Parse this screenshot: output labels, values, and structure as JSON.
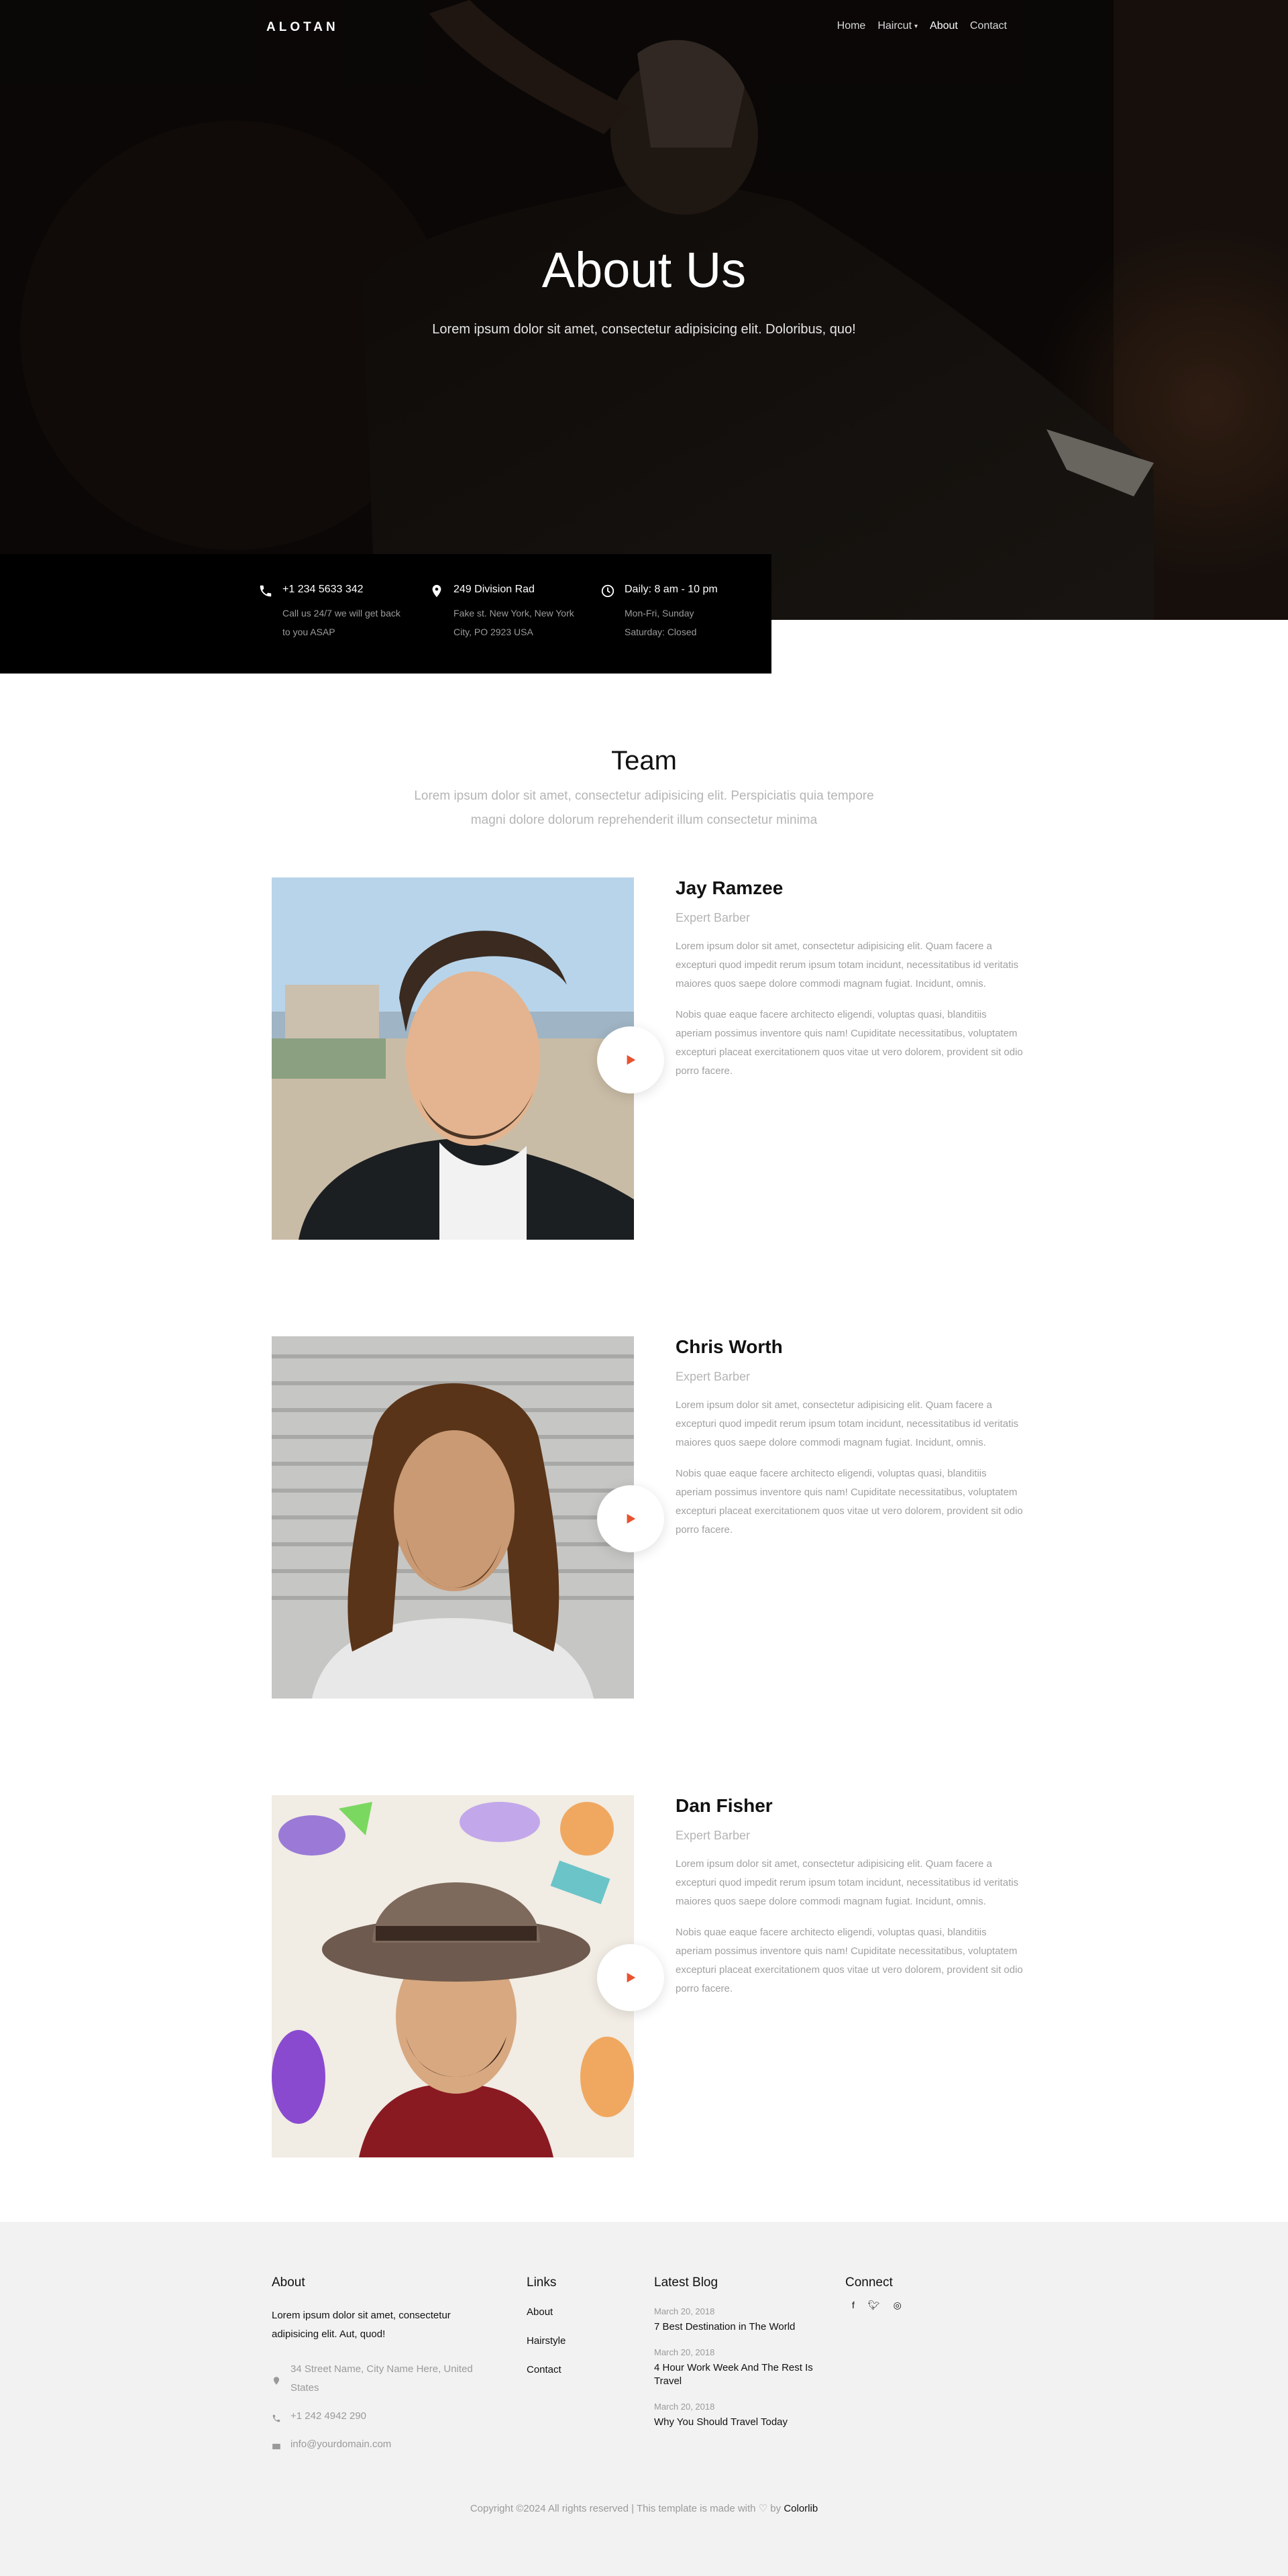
{
  "colors": {
    "accent": "#e8522e",
    "hero_bg": "#17100e",
    "footer_bg": "#f2f2f2"
  },
  "nav": {
    "logo": "ALOTAN",
    "items": [
      {
        "label": "Home"
      },
      {
        "label": "Haircut"
      },
      {
        "label": "About"
      },
      {
        "label": "Contact"
      }
    ]
  },
  "hero": {
    "title": "About Us",
    "subtitle": "Lorem ipsum dolor sit amet, consectetur adipisicing elit. Doloribus, quo!"
  },
  "info": [
    {
      "icon": "phone-icon",
      "title": "+1 234 5633 342",
      "lines": [
        "Call us 24/7 we will get back",
        "to you ASAP"
      ]
    },
    {
      "icon": "map-pin-icon",
      "title": "249 Division Rad",
      "lines": [
        "Fake st. New York, New York",
        "City, PO 2923 USA"
      ]
    },
    {
      "icon": "clock-icon",
      "title": "Daily: 8 am - 10 pm",
      "lines": [
        "Mon-Fri, Sunday",
        "Saturday: Closed"
      ]
    }
  ],
  "team": {
    "title": "Team",
    "description": "Lorem ipsum dolor sit amet, consectetur adipisicing elit. Perspiciatis quia tempore magni dolore dolorum reprehenderit illum consectetur minima",
    "members": [
      {
        "name": "Jay Ramzee",
        "role": "Expert Barber",
        "p1": "Lorem ipsum dolor sit amet, consectetur adipisicing elit. Quam facere a excepturi quod impedit rerum ipsum totam incidunt, necessitatibus id veritatis maiores quos saepe dolore commodi magnam fugiat. Incidunt, omnis.",
        "p2": "Nobis quae eaque facere architecto eligendi, voluptas quasi, blanditiis aperiam possimus inventore quis nam! Cupiditate necessitatibus, voluptatem excepturi placeat exercitationem quos vitae ut vero dolorem, provident sit odio porro facere."
      },
      {
        "name": "Chris Worth",
        "role": "Expert Barber",
        "p1": "Lorem ipsum dolor sit amet, consectetur adipisicing elit. Quam facere a excepturi quod impedit rerum ipsum totam incidunt, necessitatibus id veritatis maiores quos saepe dolore commodi magnam fugiat. Incidunt, omnis.",
        "p2": "Nobis quae eaque facere architecto eligendi, voluptas quasi, blanditiis aperiam possimus inventore quis nam! Cupiditate necessitatibus, voluptatem excepturi placeat exercitationem quos vitae ut vero dolorem, provident sit odio porro facere."
      },
      {
        "name": "Dan Fisher",
        "role": "Expert Barber",
        "p1": "Lorem ipsum dolor sit amet, consectetur adipisicing elit. Quam facere a excepturi quod impedit rerum ipsum totam incidunt, necessitatibus id veritatis maiores quos saepe dolore commodi magnam fugiat. Incidunt, omnis.",
        "p2": "Nobis quae eaque facere architecto eligendi, voluptas quasi, blanditiis aperiam possimus inventore quis nam! Cupiditate necessitatibus, voluptatem excepturi placeat exercitationem quos vitae ut vero dolorem, provident sit odio porro facere."
      }
    ]
  },
  "footer": {
    "about": {
      "heading": "About",
      "text": "Lorem ipsum dolor sit amet, consectetur adipisicing elit. Aut, quod!",
      "address": "34 Street Name, City Name Here, United States",
      "phone": "+1 242 4942 290",
      "email": "info@yourdomain.com"
    },
    "links": {
      "heading": "Links",
      "items": [
        "About",
        "Hairstyle",
        "Contact"
      ]
    },
    "blog": {
      "heading": "Latest Blog",
      "posts": [
        {
          "date": "March 20, 2018",
          "title": "7 Best Destination in The World"
        },
        {
          "date": "March 20, 2018",
          "title": "4 Hour Work Week And The Rest Is Travel"
        },
        {
          "date": "March 20, 2018",
          "title": "Why You Should Travel Today"
        }
      ]
    },
    "connect": {
      "heading": "Connect",
      "icons": [
        "facebook-icon",
        "twitter-icon",
        "instagram-icon"
      ]
    },
    "copyright": "Copyright ©2024 All rights reserved | This template is made with ♡ by",
    "brand": "Colorlib"
  }
}
